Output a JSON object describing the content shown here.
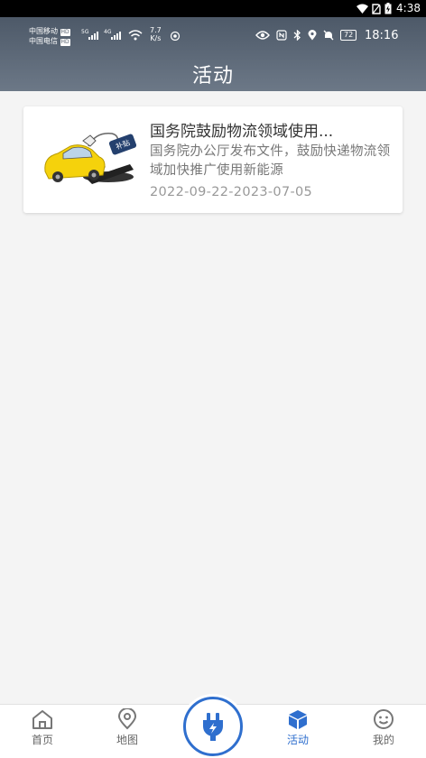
{
  "system_bar": {
    "time": "4:38"
  },
  "status": {
    "carrier1": "中国移动",
    "carrier2": "中国电信",
    "hd": "HD",
    "sig1": "5G",
    "sig2": "4G",
    "speed_value": "7.7",
    "speed_unit": "K/s",
    "battery": "72",
    "clock": "18:16"
  },
  "header": {
    "title": "活动"
  },
  "activities": [
    {
      "title": "国务院鼓励物流领域使用...",
      "description": "国务院办公厅发布文件，鼓励快递物流领域加快推广使用新能源",
      "date_range": "2022-09-22-2023-07-05",
      "thumb_tag": "补贴"
    }
  ],
  "tabbar": {
    "home": "首页",
    "map": "地图",
    "activity": "活动",
    "mine": "我的"
  },
  "colors": {
    "accent": "#2f6fce",
    "header": "#5a6575"
  }
}
